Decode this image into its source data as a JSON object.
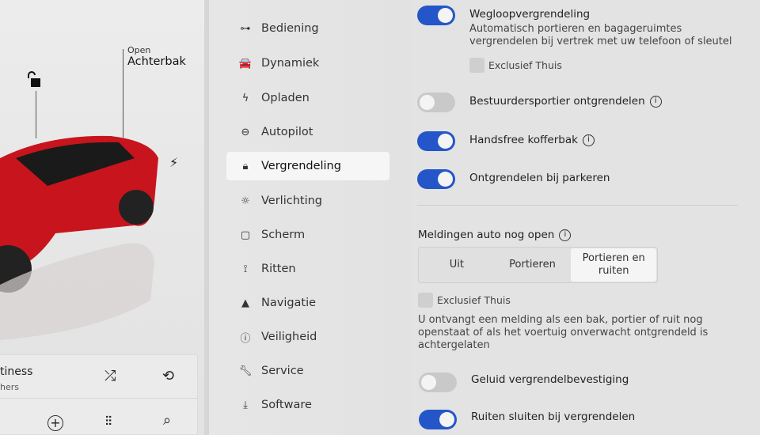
{
  "vehicle": {
    "trunk_status": "Open",
    "trunk_label": "Achterbak"
  },
  "media": {
    "title": "tiness",
    "subtitle": "hers"
  },
  "menu": [
    {
      "label": "Bediening",
      "icon": "toggle-icon"
    },
    {
      "label": "Dynamiek",
      "icon": "car-icon"
    },
    {
      "label": "Opladen",
      "icon": "bolt-icon"
    },
    {
      "label": "Autopilot",
      "icon": "steering-wheel-icon"
    },
    {
      "label": "Vergrendeling",
      "icon": "lock-icon",
      "selected": true
    },
    {
      "label": "Verlichting",
      "icon": "sun-icon"
    },
    {
      "label": "Scherm",
      "icon": "display-icon"
    },
    {
      "label": "Ritten",
      "icon": "trips-icon"
    },
    {
      "label": "Navigatie",
      "icon": "navigation-icon"
    },
    {
      "label": "Veiligheid",
      "icon": "safety-icon"
    },
    {
      "label": "Service",
      "icon": "wrench-icon"
    },
    {
      "label": "Software",
      "icon": "download-icon"
    }
  ],
  "settings": {
    "walkaway": {
      "label": "Wegloopvergrendeling",
      "desc1": "Automatisch portieren en bagageruimtes",
      "desc2": "vergrendelen bij vertrek met uw telefoon of sleutel",
      "on": true,
      "exclude_home": "Exclusief Thuis"
    },
    "driver_door": {
      "label": "Bestuurdersportier ontgrendelen",
      "on": false
    },
    "handsfree": {
      "label": "Handsfree kofferbak",
      "on": true
    },
    "park_unlock": {
      "label": "Ontgrendelen bij parkeren",
      "on": true
    },
    "open_alert": {
      "label": "Meldingen auto nog open",
      "options": [
        "Uit",
        "Portieren",
        "Portieren en ruiten"
      ],
      "selected": "Portieren en ruiten",
      "exclude_home": "Exclusief Thuis",
      "desc1": "U ontvangt een melding als een bak, portier of ruit nog",
      "desc2": "openstaat of als het voertuig onverwacht ontgrendeld is",
      "desc3": "achtergelaten"
    },
    "lock_sound": {
      "label": "Geluid vergrendelbevestiging",
      "on": false
    },
    "close_windows": {
      "label": "Ruiten sluiten bij vergrendelen",
      "on": true
    }
  },
  "colors": {
    "accent": "#2456c9",
    "car": "#c8141c"
  }
}
